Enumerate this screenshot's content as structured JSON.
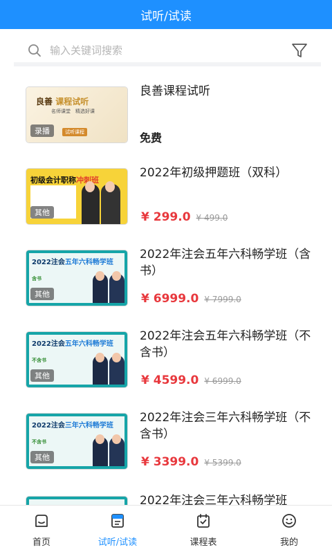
{
  "header": {
    "title": "试听/试读"
  },
  "search": {
    "placeholder": "输入关键词搜索"
  },
  "colors": {
    "accent": "#1e90ff",
    "price": "#e8383d"
  },
  "courses": [
    {
      "title": "良善课程试听",
      "price": "免费",
      "thumb_tag": "录播",
      "thumb_text": {
        "brand": "良善",
        "brand_em": "课程试听",
        "sub": "名师课堂　精选好课",
        "pill": "试听课程"
      }
    },
    {
      "title": "2022年初级押题班（双科）",
      "price": "¥ 299.0",
      "old_price": "¥ 499.0",
      "thumb_tag": "其他",
      "thumb_text": {
        "brand": "初级会计职称",
        "brand_em": "冲刺班"
      }
    },
    {
      "title": "2022年注会五年六科畅学班（含书）",
      "price": "¥ 6999.0",
      "old_price": "¥ 7999.0",
      "thumb_tag": "其他",
      "thumb_text": {
        "brand": "2022注会",
        "brand_em": "五年六科畅学班",
        "green": "含书"
      }
    },
    {
      "title": "2022年注会五年六科畅学班（不含书）",
      "price": "¥ 4599.0",
      "old_price": "¥ 6999.0",
      "thumb_tag": "其他",
      "thumb_text": {
        "brand": "2022注会",
        "brand_em": "五年六科畅学班",
        "green": "不含书"
      }
    },
    {
      "title": "2022年注会三年六科畅学班（不含书）",
      "price": "¥ 3399.0",
      "old_price": "¥ 5399.0",
      "thumb_tag": "其他",
      "thumb_text": {
        "brand": "2022注会",
        "brand_em": "三年六科畅学班",
        "green": "不含书"
      }
    },
    {
      "title": "2022年注会三年六科畅学班"
    }
  ],
  "tabbar": [
    {
      "label": "首页",
      "icon": "home-icon",
      "active": false
    },
    {
      "label": "试听/试读",
      "icon": "book-icon",
      "active": true
    },
    {
      "label": "课程表",
      "icon": "calendar-icon",
      "active": false
    },
    {
      "label": "我的",
      "icon": "smile-icon",
      "active": false
    }
  ]
}
